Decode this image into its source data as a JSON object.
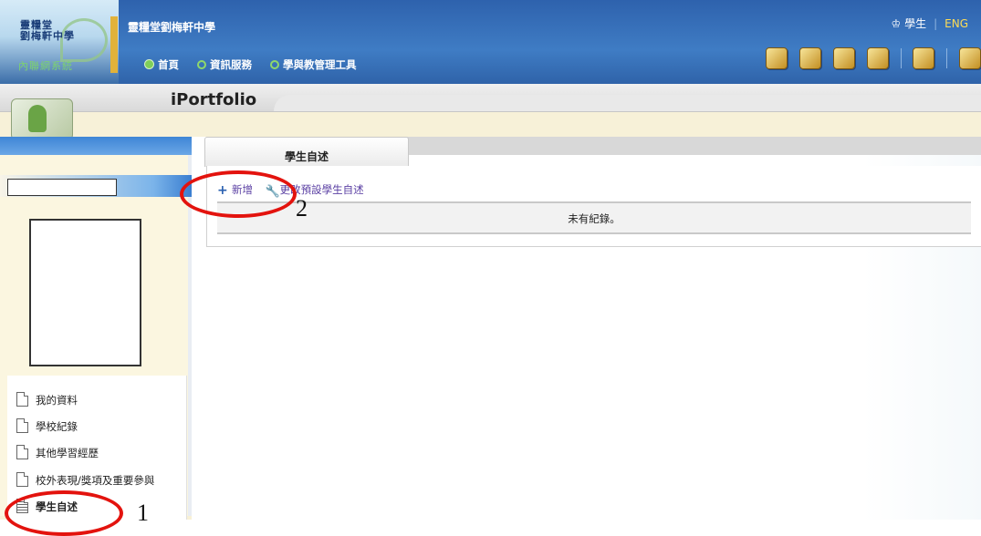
{
  "header": {
    "logo": {
      "line1": "靈糧堂",
      "line2": "劉梅軒中學",
      "line3": "內聯網系統"
    },
    "school_name": "靈糧堂劉梅軒中學",
    "user_label": "學生",
    "language_link": "ENG",
    "nav": [
      {
        "label": "首頁",
        "icon": "home-dot-icon"
      },
      {
        "label": "資訊服務",
        "icon": "circle-icon"
      },
      {
        "label": "學與教管理工具",
        "icon": "circle-icon"
      }
    ],
    "tool_icons": [
      "calendar-icon",
      "clipboard-icon",
      "mail-icon",
      "notebook-icon",
      "group-icon",
      "book-icon"
    ]
  },
  "page": {
    "title": "iPortfolio"
  },
  "sidebar": {
    "student_name": "",
    "menu": [
      {
        "label": "我的資料"
      },
      {
        "label": "學校紀錄"
      },
      {
        "label": "其他學習經歷"
      },
      {
        "label": "校外表現/獎項及重要參與"
      },
      {
        "label": "學生自述",
        "active": true
      }
    ]
  },
  "content": {
    "tab_label": "學生自述",
    "actions": {
      "add": "新增",
      "edit_default": "更改預設學生自述"
    },
    "empty_message": "未有紀錄。"
  },
  "annotations": {
    "first": "1",
    "second": "2"
  },
  "colors": {
    "header_blue": "#3f7cc4",
    "accent_red": "#e3130e",
    "link_purple": "#5a3fa3",
    "eng_yellow": "#ffdd55"
  }
}
